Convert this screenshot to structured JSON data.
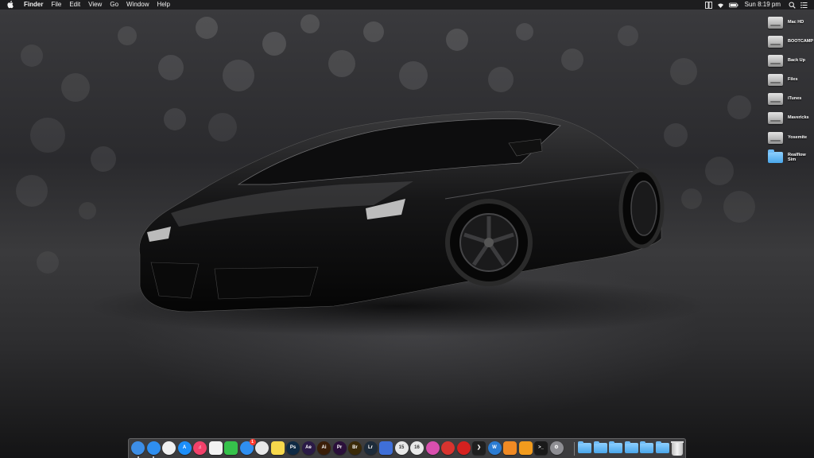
{
  "menubar": {
    "app_name": "Finder",
    "items": [
      "File",
      "Edit",
      "View",
      "Go",
      "Window",
      "Help"
    ],
    "status_icons": [
      "window-tile-icon",
      "wifi-icon",
      "battery-icon"
    ],
    "clock": "Sun 8:19 pm",
    "spotlight_icon": "search-icon",
    "notifications_icon": "list-icon"
  },
  "desktop_icons": [
    {
      "label": "Mac HD",
      "type": "drive"
    },
    {
      "label": "BOOTCAMP",
      "type": "drive"
    },
    {
      "label": "Back Up",
      "type": "drive"
    },
    {
      "label": "Files",
      "type": "drive"
    },
    {
      "label": "iTunes",
      "type": "drive"
    },
    {
      "label": "Mavericks",
      "type": "drive"
    },
    {
      "label": "Yosemite",
      "type": "drive"
    },
    {
      "label": "Realflow Sim",
      "type": "folder"
    }
  ],
  "dock": {
    "apps": [
      {
        "name": "finder",
        "glyph": "",
        "color": "#3d8ee6",
        "round": true,
        "running": true
      },
      {
        "name": "safari",
        "glyph": "",
        "color": "#2f8ff0",
        "round": true,
        "running": true
      },
      {
        "name": "clock",
        "glyph": "",
        "color": "#f0f0f0",
        "round": true,
        "running": false
      },
      {
        "name": "app-store",
        "glyph": "A",
        "color": "#1c8ef9",
        "round": true,
        "running": false
      },
      {
        "name": "itunes",
        "glyph": "♫",
        "color": "#f2416a",
        "round": true,
        "running": false
      },
      {
        "name": "calendar",
        "glyph": "",
        "color": "#f2f2f2",
        "round": false,
        "running": false
      },
      {
        "name": "facetime",
        "glyph": "",
        "color": "#36c24b",
        "round": false,
        "running": false
      },
      {
        "name": "messages",
        "glyph": "",
        "color": "#2f8ff0",
        "round": true,
        "running": false,
        "badge": "1"
      },
      {
        "name": "photos",
        "glyph": "",
        "color": "#e8e8e8",
        "round": true,
        "running": false
      },
      {
        "name": "notes",
        "glyph": "",
        "color": "#f7d84c",
        "round": false,
        "running": false
      },
      {
        "name": "photoshop",
        "glyph": "Ps",
        "color": "#0f2a44",
        "round": true,
        "running": false
      },
      {
        "name": "after-effects",
        "glyph": "Ae",
        "color": "#2a1a46",
        "round": true,
        "running": false
      },
      {
        "name": "illustrator",
        "glyph": "Ai",
        "color": "#3a1e08",
        "round": true,
        "running": false
      },
      {
        "name": "premiere",
        "glyph": "Pr",
        "color": "#2a0f3a",
        "round": true,
        "running": false
      },
      {
        "name": "bridge",
        "glyph": "Br",
        "color": "#3a2a08",
        "round": true,
        "running": false
      },
      {
        "name": "lightroom",
        "glyph": "Lr",
        "color": "#1d2b3a",
        "round": true,
        "running": false
      },
      {
        "name": "keynote",
        "glyph": "",
        "color": "#3f6fd8",
        "round": false,
        "running": false
      },
      {
        "name": "app-15",
        "glyph": "15",
        "color": "#e8e8e8",
        "round": true,
        "running": false
      },
      {
        "name": "app-16",
        "glyph": "16",
        "color": "#e8e8e8",
        "round": true,
        "running": false
      },
      {
        "name": "color-wheel",
        "glyph": "",
        "color": "#d94fae",
        "round": true,
        "running": false
      },
      {
        "name": "davinci",
        "glyph": "",
        "color": "#d8342f",
        "round": true,
        "running": false
      },
      {
        "name": "acrobat",
        "glyph": "",
        "color": "#d5211f",
        "round": true,
        "running": false
      },
      {
        "name": "plex",
        "glyph": "❯",
        "color": "#1f1f1f",
        "round": false,
        "running": false
      },
      {
        "name": "word",
        "glyph": "W",
        "color": "#2b7cd3",
        "round": true,
        "running": false
      },
      {
        "name": "books",
        "glyph": "",
        "color": "#f08a24",
        "round": false,
        "running": false
      },
      {
        "name": "pages",
        "glyph": "",
        "color": "#f29b1d",
        "round": false,
        "running": false
      },
      {
        "name": "terminal",
        "glyph": ">_",
        "color": "#1a1a1a",
        "round": false,
        "running": false
      },
      {
        "name": "system-preferences",
        "glyph": "⚙",
        "color": "#8e8e93",
        "round": true,
        "running": false
      }
    ],
    "folders": [
      "applications",
      "downloads",
      "documents",
      "desktop",
      "pictures",
      "movies"
    ],
    "trash_icon": "trash-icon"
  }
}
